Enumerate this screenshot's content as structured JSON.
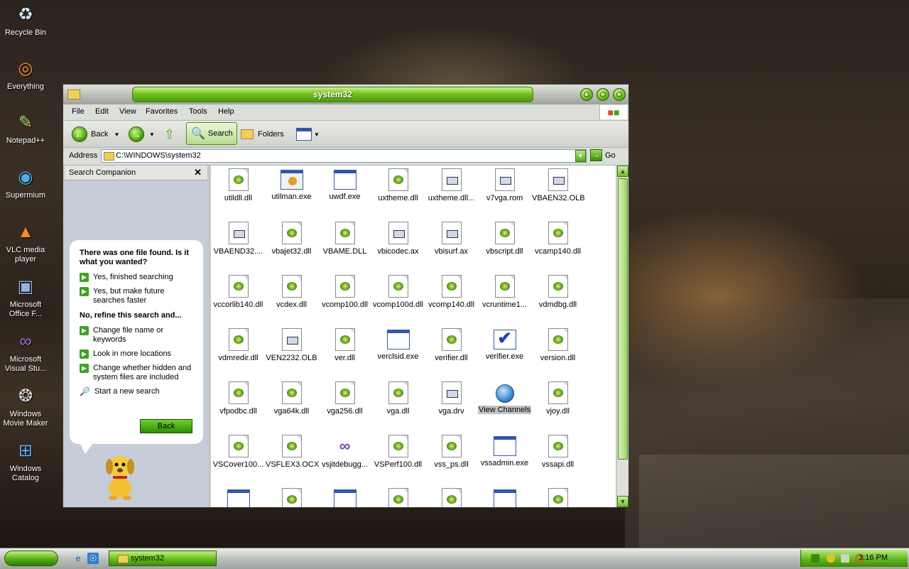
{
  "desktop": {
    "icons": [
      {
        "label": "Recycle Bin",
        "icon": "recycle-bin-icon"
      },
      {
        "label": "Everything",
        "icon": "everything-icon"
      },
      {
        "label": "Notepad++",
        "icon": "notepad-icon"
      },
      {
        "label": "Supermium",
        "icon": "browser-icon"
      },
      {
        "label": "VLC media player",
        "icon": "vlc-icon"
      },
      {
        "label": "Microsoft Office F...",
        "icon": "office-icon"
      },
      {
        "label": "Microsoft Visual Stu...",
        "icon": "visual-studio-icon"
      },
      {
        "label": "Windows Movie Maker",
        "icon": "movie-maker-icon"
      },
      {
        "label": "Windows Catalog",
        "icon": "catalog-icon"
      }
    ]
  },
  "window": {
    "title": "system32",
    "menu": [
      "File",
      "Edit",
      "View",
      "Favorites",
      "Tools",
      "Help"
    ],
    "toolbar": {
      "back": "Back",
      "search": "Search",
      "folders": "Folders"
    },
    "address": {
      "label": "Address",
      "value": "C:\\WINDOWS\\system32",
      "go": "Go"
    }
  },
  "search_companion": {
    "header": "Search Companion",
    "question": "There was one file found.  Is it what you wanted?",
    "options_yes": [
      "Yes, finished searching",
      "Yes, but make future searches faster"
    ],
    "refine_heading": "No, refine this search and...",
    "options_refine": [
      "Change file name or keywords",
      "Look in more locations",
      "Change whether hidden and system files are included"
    ],
    "new_search": "Start a new search",
    "back_button": "Back"
  },
  "files": [
    {
      "name": "utildll.dll",
      "type": "dll"
    },
    {
      "name": "utilman.exe",
      "type": "utilman"
    },
    {
      "name": "uwdf.exe",
      "type": "exe"
    },
    {
      "name": "uxtheme.dll",
      "type": "dll"
    },
    {
      "name": "uxtheme.dll...",
      "type": "sys"
    },
    {
      "name": "v7vga.rom",
      "type": "sys"
    },
    {
      "name": "VBAEN32.OLB",
      "type": "sys"
    },
    {
      "name": "VBAEND32....",
      "type": "sys"
    },
    {
      "name": "vbajet32.dll",
      "type": "dll"
    },
    {
      "name": "VBAME.DLL",
      "type": "dll"
    },
    {
      "name": "vbicodec.ax",
      "type": "sys"
    },
    {
      "name": "vbisurf.ax",
      "type": "sys"
    },
    {
      "name": "vbscript.dll",
      "type": "dll"
    },
    {
      "name": "vcamp140.dll",
      "type": "dll"
    },
    {
      "name": "vccorlib140.dll",
      "type": "dll"
    },
    {
      "name": "vcdex.dll",
      "type": "dll"
    },
    {
      "name": "vcomp100.dll",
      "type": "dll"
    },
    {
      "name": "vcomp100d.dll",
      "type": "dll"
    },
    {
      "name": "vcomp140.dll",
      "type": "dll"
    },
    {
      "name": "vcruntime1...",
      "type": "dll"
    },
    {
      "name": "vdmdbg.dll",
      "type": "dll"
    },
    {
      "name": "vdmredir.dll",
      "type": "dll"
    },
    {
      "name": "VEN2232.OLB",
      "type": "sys"
    },
    {
      "name": "ver.dll",
      "type": "dll"
    },
    {
      "name": "verclsid.exe",
      "type": "exe"
    },
    {
      "name": "verifier.dll",
      "type": "dll"
    },
    {
      "name": "verifier.exe",
      "type": "chk"
    },
    {
      "name": "version.dll",
      "type": "dll"
    },
    {
      "name": "vfpodbc.dll",
      "type": "dll"
    },
    {
      "name": "vga64k.dll",
      "type": "dll"
    },
    {
      "name": "vga256.dll",
      "type": "dll"
    },
    {
      "name": "vga.dll",
      "type": "dll"
    },
    {
      "name": "vga.drv",
      "type": "sys"
    },
    {
      "name": "View Channels",
      "type": "globe",
      "selected": true
    },
    {
      "name": "vjoy.dll",
      "type": "dll"
    },
    {
      "name": "VSCover100...",
      "type": "dll"
    },
    {
      "name": "VSFLEX3.OCX",
      "type": "dll"
    },
    {
      "name": "vsjitdebugg...",
      "type": "vs"
    },
    {
      "name": "VSPerf100.dll",
      "type": "dll"
    },
    {
      "name": "vss_ps.dll",
      "type": "dll"
    },
    {
      "name": "vssadmin.exe",
      "type": "exe"
    },
    {
      "name": "vssapi.dll",
      "type": "dll"
    },
    {
      "name": "",
      "type": "exe"
    },
    {
      "name": "",
      "type": "dll"
    },
    {
      "name": "",
      "type": "exe"
    },
    {
      "name": "",
      "type": "dll"
    },
    {
      "name": "",
      "type": "dll"
    },
    {
      "name": "",
      "type": "exe"
    },
    {
      "name": "",
      "type": "dll"
    }
  ],
  "taskbar": {
    "task_label": "system32",
    "clock": "3:16 PM"
  }
}
